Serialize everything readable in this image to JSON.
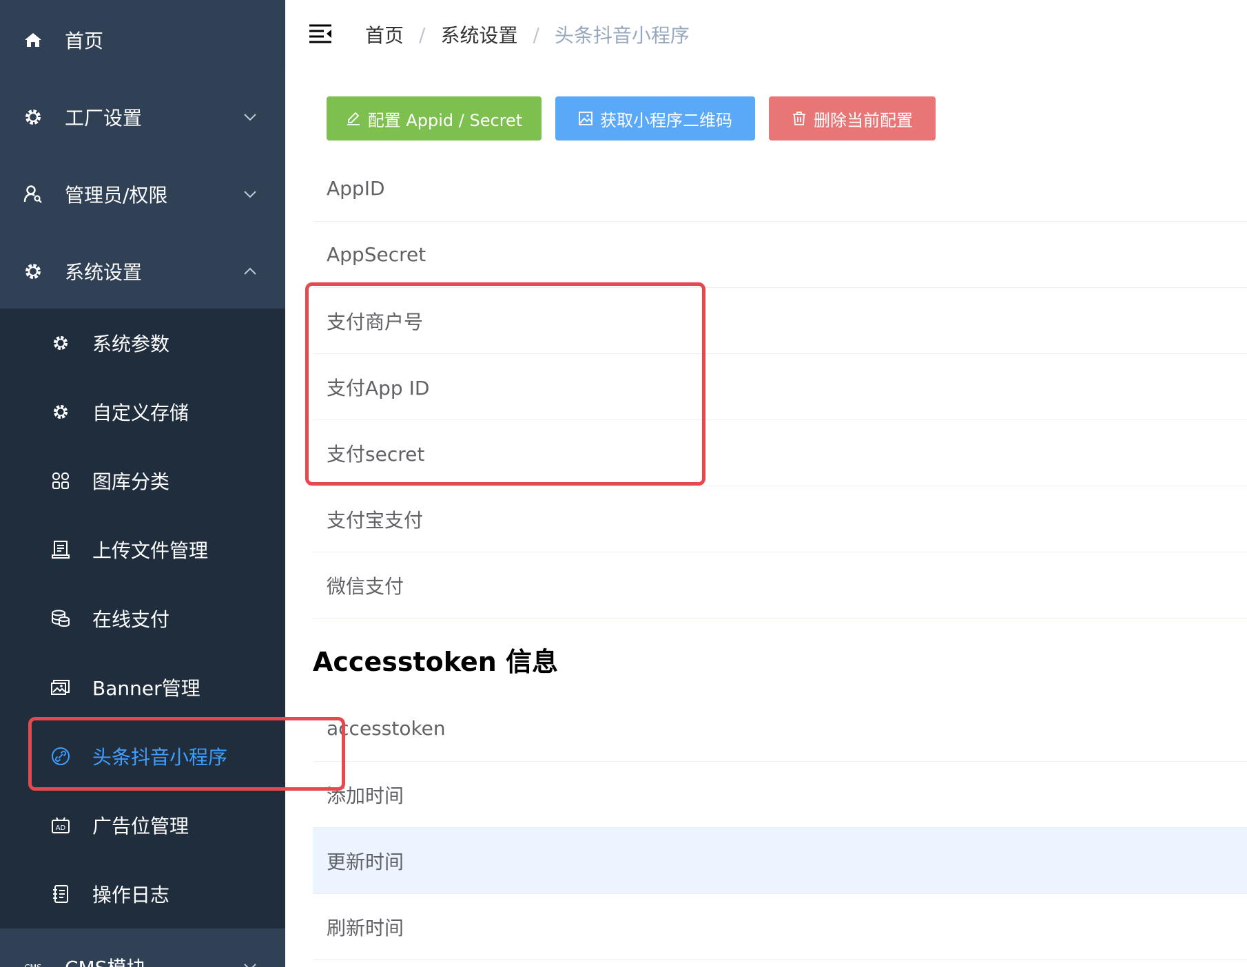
{
  "breadcrumb": {
    "items": [
      "首页",
      "系统设置",
      "头条抖音小程序"
    ],
    "separator": "/"
  },
  "sidebar": {
    "items": [
      {
        "label": "首页",
        "icon": "home-icon"
      },
      {
        "label": "工厂设置",
        "icon": "gear-icon",
        "expanded": false
      },
      {
        "label": "管理员/权限",
        "icon": "user-key-icon",
        "expanded": false
      },
      {
        "label": "系统设置",
        "icon": "gear-icon",
        "expanded": true
      }
    ],
    "submenu": [
      {
        "label": "系统参数",
        "icon": "gear-icon"
      },
      {
        "label": "自定义存储",
        "icon": "gear-icon"
      },
      {
        "label": "图库分类",
        "icon": "grid-icon"
      },
      {
        "label": "上传文件管理",
        "icon": "upload-file-icon"
      },
      {
        "label": "在线支付",
        "icon": "coins-icon"
      },
      {
        "label": "Banner管理",
        "icon": "image-icon"
      },
      {
        "label": "头条抖音小程序",
        "icon": "link-icon",
        "active": true
      },
      {
        "label": "广告位管理",
        "icon": "ad-icon"
      },
      {
        "label": "操作日志",
        "icon": "log-icon"
      }
    ],
    "next_item": {
      "label": "CMS模块",
      "icon": "cms-icon",
      "expanded": false
    }
  },
  "toolbar": {
    "config_label": "配置 Appid / Secret",
    "qrcode_label": "获取小程序二维码",
    "delete_label": "删除当前配置"
  },
  "config_rows": [
    "AppID",
    "AppSecret",
    "支付商户号",
    "支付App ID",
    "支付secret",
    "支付宝支付",
    "微信支付"
  ],
  "token_section": {
    "title": "Accesstoken 信息",
    "rows": [
      "accesstoken",
      "添加时间",
      "更新时间",
      "刷新时间"
    ]
  },
  "colors": {
    "sidebar_bg": "#304156",
    "submenu_bg": "#1f2d3d",
    "active_text": "#409eff",
    "btn_success": "#7ec050",
    "btn_primary": "#5aa9f8",
    "btn_danger": "#e97676",
    "annotation": "#e5484d",
    "row_hover": "#ecf5ff"
  }
}
